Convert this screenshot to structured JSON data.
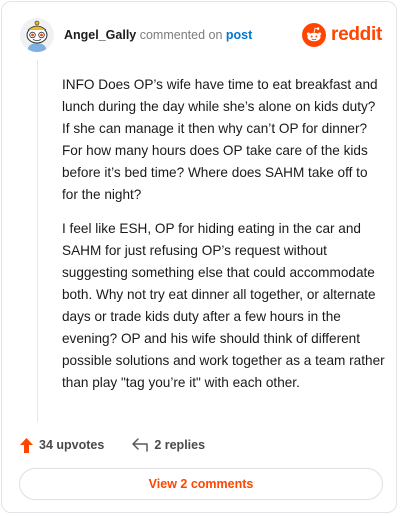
{
  "header": {
    "username": "Angel_Gally",
    "action_text": "commented on",
    "target_text": "post",
    "brand_name": "reddit"
  },
  "comment": {
    "paragraphs": [
      "INFO Does OP’s wife have time to eat breakfast and lunch during the day while she’s alone on kids duty? If she can manage it then why can’t OP for dinner? For how many hours does OP take care of the kids before it’s bed time? Where does SAHM take off to for the night?",
      "I feel like ESH, OP for hiding eating in the car and SAHM for just refusing OP’s request without suggesting something else that could accommodate both. Why not try eat dinner all together, or alternate days or trade kids duty after a few hours in the evening? OP and his wife should think of different possible solutions and work together as a team rather than play \"tag you’re it\" with each other."
    ]
  },
  "footer": {
    "upvotes": "34 upvotes",
    "replies": "2 replies",
    "view_button": "View 2 comments"
  },
  "colors": {
    "brand_orange": "#ff4500",
    "link_blue": "#0079d3"
  },
  "icons": {
    "avatar": "snoo-avatar",
    "brand": "reddit-logo-icon",
    "upvote": "upvote-arrow-icon",
    "reply": "reply-arrow-icon"
  }
}
